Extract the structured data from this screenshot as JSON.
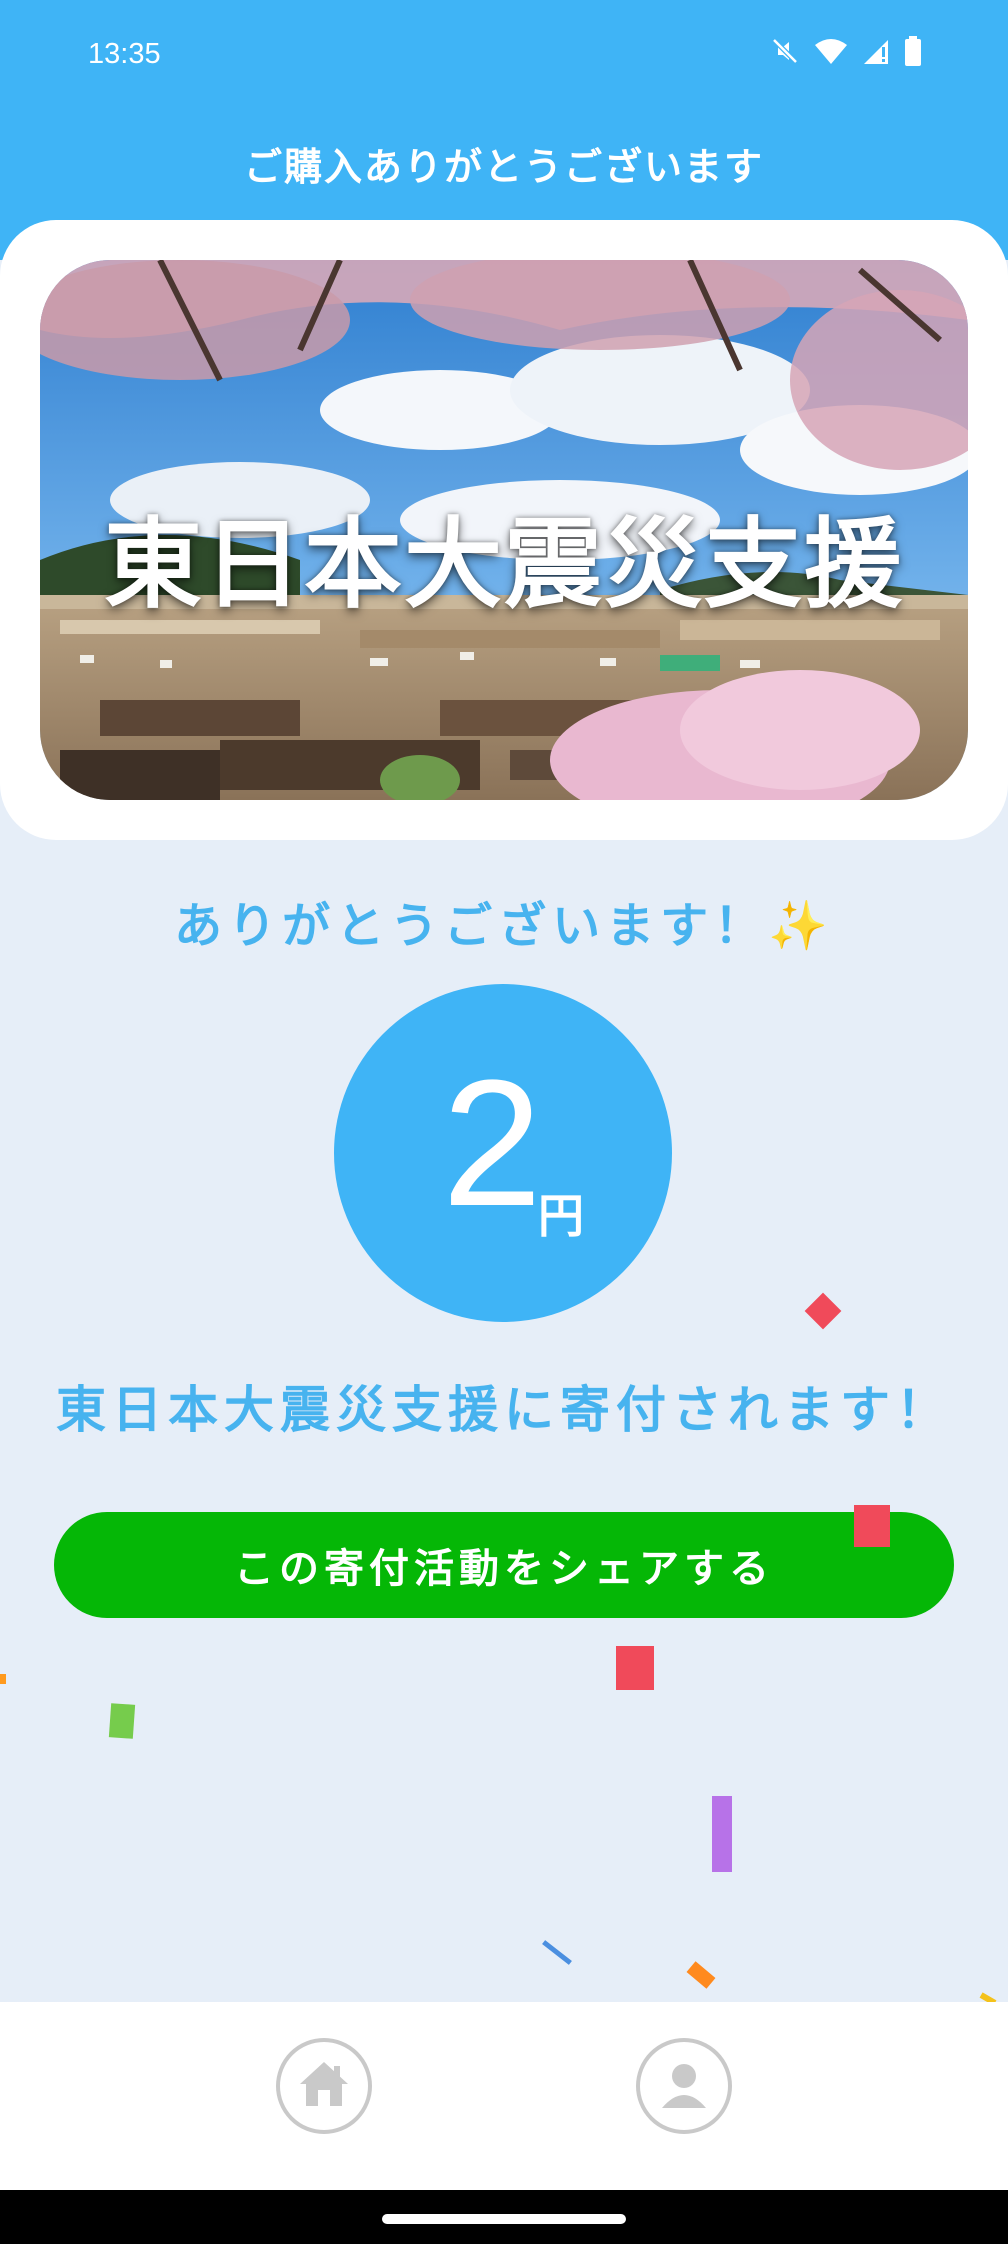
{
  "status_bar": {
    "time": "13:35",
    "icons": [
      "mute-icon",
      "wifi-icon",
      "signal-icon",
      "battery-icon"
    ]
  },
  "header": {
    "title": "ご購入ありがとうございます"
  },
  "hero": {
    "caption": "東日本大震災支援"
  },
  "thanks": {
    "text": "ありがとうございます！",
    "emoji": "✨"
  },
  "amount": {
    "value": "2",
    "unit": "円"
  },
  "message": {
    "text": "東日本大震災支援に寄付されます！"
  },
  "share_button": {
    "label": "この寄付活動をシェアする"
  },
  "bottom_nav": {
    "items": [
      {
        "icon": "home-icon"
      },
      {
        "icon": "profile-icon"
      }
    ]
  },
  "colors": {
    "header": "#3fb4f6",
    "accent_text": "#47b3ef",
    "share_button": "#05b706",
    "background": "#e6eef8"
  }
}
